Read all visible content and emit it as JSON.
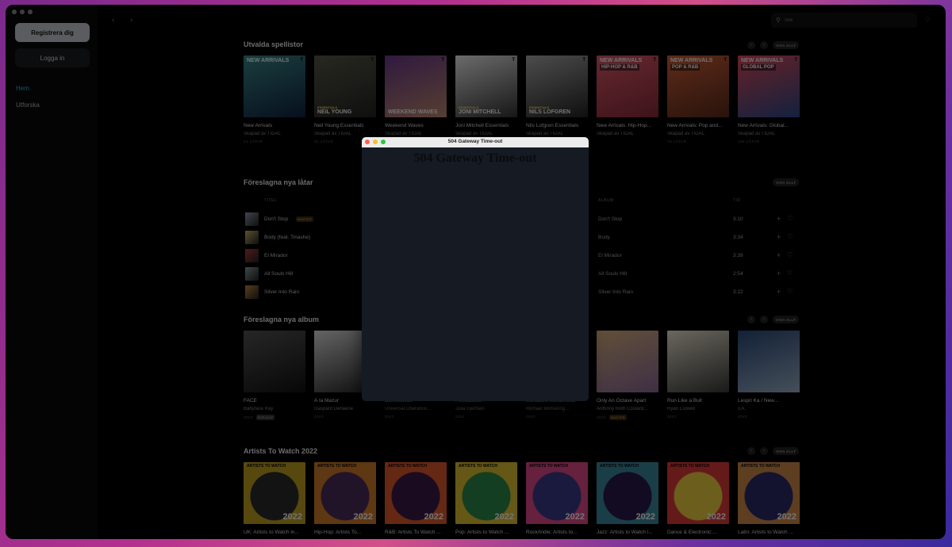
{
  "sidebar": {
    "register_label": "Registrera dig",
    "login_label": "Logga in",
    "nav": [
      "Hem",
      "Utforska"
    ],
    "accent": "#36b5e6"
  },
  "topbar": {
    "search_placeholder": "Sök"
  },
  "sections": {
    "playlists": {
      "title": "Utvalda spellistor",
      "view_all": "VISA ALLT",
      "items": [
        {
          "title": "New Arrivals",
          "sub": "Skapad av TIDAL",
          "meta": "41 LÅTAR",
          "cover_text": "NEW ARRIVALS",
          "cover_text2": "",
          "colors": [
            "#3a8a8a",
            "#124"
          ]
        },
        {
          "title": "Neil Young Essentials",
          "sub": "Skapad av TIDAL",
          "meta": "42 LÅTAR",
          "cover_text": "NEIL YOUNG",
          "cover_text2": "ESSENTIALS",
          "colors": [
            "#5a5a4a",
            "#222"
          ]
        },
        {
          "title": "Weekend Waves",
          "sub": "Skapad av TIDAL",
          "meta": "",
          "cover_text": "WEEKEND WAVES",
          "cover_text2": "",
          "colors": [
            "#6a3a8a",
            "#c08a70"
          ]
        },
        {
          "title": "Joni Mitchell Essentials",
          "sub": "Skapad av TIDAL",
          "meta": "",
          "cover_text": "JONI MITCHELL",
          "cover_text2": "ESSENTIALS",
          "colors": [
            "#eee",
            "#333"
          ]
        },
        {
          "title": "Nils Lofgren Essentials",
          "sub": "Skapad av TIDAL",
          "meta": "",
          "cover_text": "NILS LOFGREN",
          "cover_text2": "ESSENTIALS",
          "colors": [
            "#aaa",
            "#222"
          ]
        },
        {
          "title": "New Arrivals: Hip-Hop...",
          "sub": "Skapad av TIDAL",
          "meta": "",
          "cover_text": "NEW ARRIVALS",
          "cover_text2": "HIP-HOP & R&B",
          "colors": [
            "#e05a6a",
            "#8a2a3a"
          ]
        },
        {
          "title": "New Arrivals: Pop and...",
          "sub": "Skapad av TIDAL",
          "meta": "75 LÅTAR",
          "cover_text": "NEW ARRIVALS",
          "cover_text2": "POP & R&B",
          "colors": [
            "#d0603a",
            "#5a2a1a"
          ]
        },
        {
          "title": "New Arrivals: Global...",
          "sub": "Skapad av TIDAL",
          "meta": "106 LÅTAR",
          "cover_text": "NEW ARRIVALS",
          "cover_text2": "GLOBAL POP",
          "colors": [
            "#e04a5a",
            "#2a4a8a"
          ]
        }
      ]
    },
    "tracks": {
      "title": "Föreslagna nya låtar",
      "view_all": "VISA ALLT",
      "headers": {
        "title": "TITEL",
        "album": "ALBUM",
        "time": "TID"
      },
      "rows": [
        {
          "title": "Don't Stop",
          "badge": "MASTER",
          "album": "Don't Stop",
          "time": "3:10",
          "color": "#8a9aaa"
        },
        {
          "title": "Body (feat. Tinashe)",
          "badge": "",
          "album": "Body",
          "time": "3:34",
          "color": "#c8b46a"
        },
        {
          "title": "El Mirador",
          "badge": "",
          "album": "El Mirador",
          "time": "3:39",
          "color": "#b03a3a"
        },
        {
          "title": "All Souls Hill",
          "badge": "",
          "album": "All Souls Hill",
          "time": "2:54",
          "color": "#8a9a9a"
        },
        {
          "title": "Silver Into Rain",
          "badge": "",
          "album": "Silver Into Rain",
          "time": "3:22",
          "color": "#c08a3a"
        }
      ]
    },
    "albums": {
      "title": "Föreslagna nya album",
      "view_all": "VISA ALLT",
      "items": [
        {
          "title": "FACE",
          "sub": "Babyface Ray",
          "meta": "2022",
          "badge": "EXPLICIT",
          "colors": [
            "#555",
            "#111"
          ]
        },
        {
          "title": "À la Mazur",
          "sub": "Gaspard Dehaene",
          "meta": "2022",
          "badge": "",
          "colors": [
            "#ddd",
            "#222"
          ]
        },
        {
          "title": "Communion",
          "sub": "Universal Liberation...",
          "meta": "2022",
          "badge": "",
          "colors": [
            "#333",
            "#111"
          ]
        },
        {
          "title": "Formations",
          "sub": "Julia Gjertsen",
          "meta": "2022",
          "badge": "",
          "colors": [
            "#333",
            "#111"
          ]
        },
        {
          "title": "Schubert: Winterreise",
          "sub": "Michael Wilmering...",
          "meta": "2022",
          "badge": "",
          "colors": [
            "#333",
            "#111"
          ]
        },
        {
          "title": "Only An Octave Apart",
          "sub": "Anthony Roth Costanz...",
          "meta": "2022",
          "badge": "MASTER",
          "colors": [
            "#d8b080",
            "#8a6a9a"
          ]
        },
        {
          "title": "Run Like a Bull",
          "sub": "Ryan Culwell",
          "meta": "2022",
          "badge": "",
          "colors": [
            "#e8e4d0",
            "#3a3a3a"
          ]
        },
        {
          "title": "Lespri Ka / New...",
          "sub": "v.A.",
          "meta": "2022",
          "badge": "",
          "colors": [
            "#2a4a7a",
            "#9ab0c8"
          ]
        }
      ]
    },
    "artists": {
      "title": "Artists To Watch 2022",
      "view_all": "VISA ALLT",
      "items": [
        {
          "title": "UK: Artists to Watch in...",
          "colors": [
            "#c0a020",
            "#2a2a2a"
          ]
        },
        {
          "title": "Hip-Hop: Artists To...",
          "colors": [
            "#d07a2a",
            "#4a2a5a"
          ]
        },
        {
          "title": "R&B: Artists To Watch ...",
          "colors": [
            "#e05a2a",
            "#3a1a4a"
          ]
        },
        {
          "title": "Pop: Artists to Watch ...",
          "colors": [
            "#e0c030",
            "#2a8a4a"
          ]
        },
        {
          "title": "Rock/Indie: Artists to...",
          "colors": [
            "#e04a8a",
            "#3a3a8a"
          ]
        },
        {
          "title": "Jazz: Artists to Watch i...",
          "colors": [
            "#3a8aa0",
            "#2a1a4a"
          ]
        },
        {
          "title": "Dance & Electronic:...",
          "colors": [
            "#e03a3a",
            "#f0d040"
          ]
        },
        {
          "title": "Latin: Artists to Watch ...",
          "colors": [
            "#d08a4a",
            "#2a2a6a"
          ]
        }
      ],
      "cover_text": "ARTISTS TO WATCH",
      "year": "2022"
    }
  },
  "dialog": {
    "window_title": "504 Gateway Time-out",
    "heading": "504 Gateway Time-out"
  }
}
